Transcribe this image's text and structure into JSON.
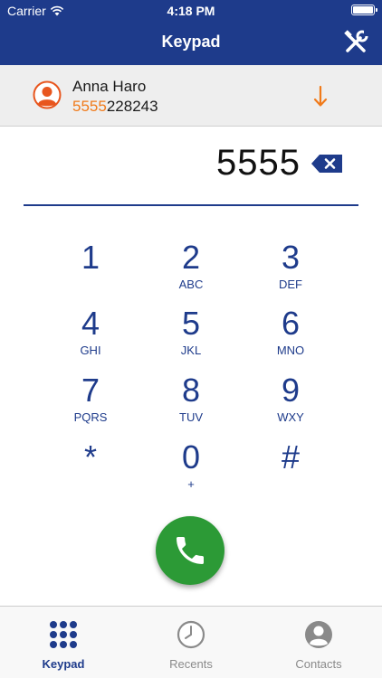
{
  "status_bar": {
    "carrier": "Carrier",
    "time": "4:18 PM"
  },
  "nav": {
    "title": "Keypad"
  },
  "contact_match": {
    "name": "Anna Haro",
    "number_match": "5555",
    "number_rest": "228243"
  },
  "dial": {
    "entered": "5555"
  },
  "keys": [
    {
      "digit": "1",
      "letters": ""
    },
    {
      "digit": "2",
      "letters": "ABC"
    },
    {
      "digit": "3",
      "letters": "DEF"
    },
    {
      "digit": "4",
      "letters": "GHI"
    },
    {
      "digit": "5",
      "letters": "JKL"
    },
    {
      "digit": "6",
      "letters": "MNO"
    },
    {
      "digit": "7",
      "letters": "PQRS"
    },
    {
      "digit": "8",
      "letters": "TUV"
    },
    {
      "digit": "9",
      "letters": "WXY"
    },
    {
      "digit": "*",
      "letters": ""
    },
    {
      "digit": "0",
      "letters": "+"
    },
    {
      "digit": "#",
      "letters": ""
    }
  ],
  "tabs": [
    {
      "label": "Keypad",
      "icon": "keypad-icon",
      "active": true
    },
    {
      "label": "Recents",
      "icon": "clock-icon",
      "active": false
    },
    {
      "label": "Contacts",
      "icon": "person-icon",
      "active": false
    }
  ],
  "colors": {
    "brand": "#1e3b8b",
    "highlight": "#f07a1a",
    "call": "#2c9a36",
    "tab_inactive": "#8a8a8a"
  }
}
